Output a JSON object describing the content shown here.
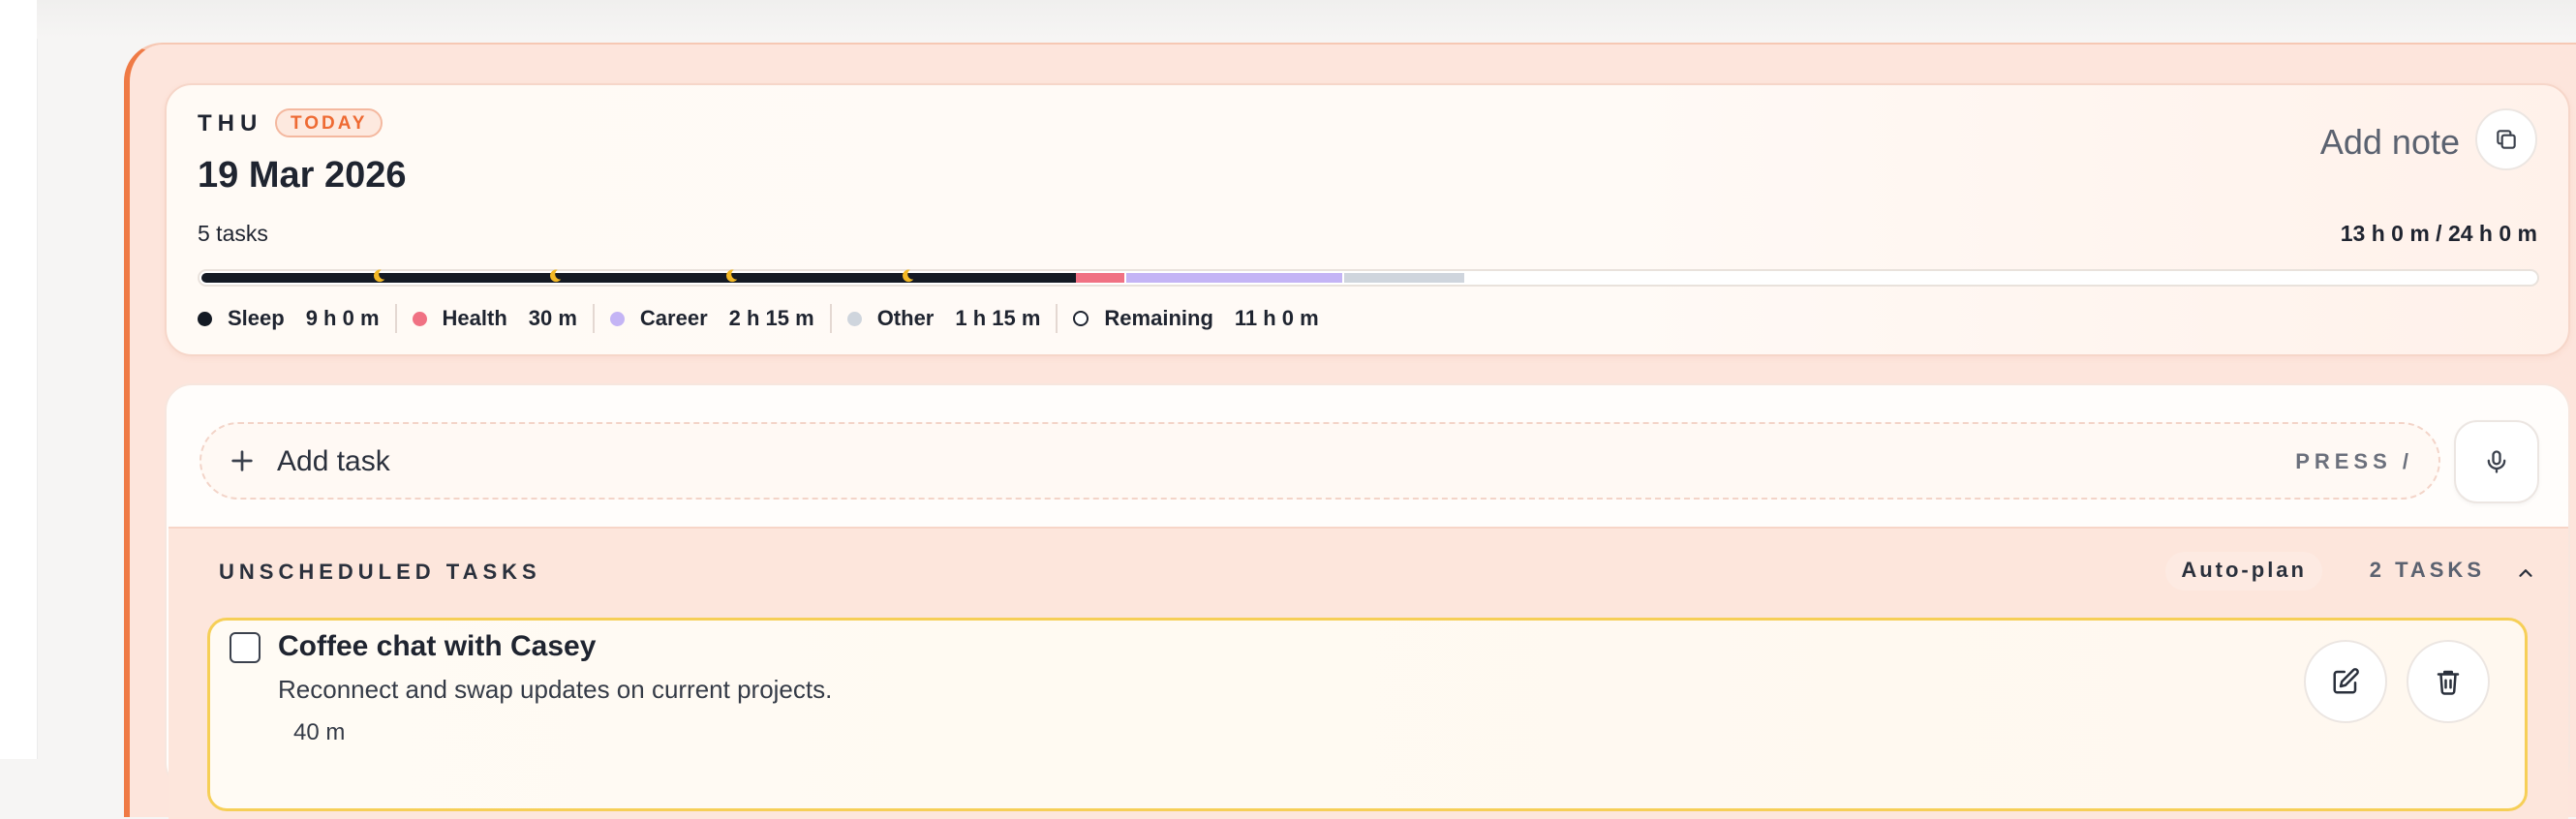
{
  "day": {
    "weekday": "THU",
    "today_badge": "TODAY",
    "date": "19 Mar 2026",
    "add_note_label": "Add note",
    "task_count": "5 tasks",
    "time_total": "13 h 0 m / 24 h 0 m"
  },
  "timeline": {
    "segments": [
      {
        "name": "Sleep",
        "fraction": 0.375,
        "color": "#141a24"
      },
      {
        "name": "Health",
        "fraction": 0.0208,
        "color": "#f07183"
      },
      {
        "name": "Career",
        "fraction": 0.0938,
        "color": "#c4b4f5"
      },
      {
        "name": "Other",
        "fraction": 0.0521,
        "color": "#cfd5dd"
      }
    ],
    "moon_icon": "moon-icon"
  },
  "legend": [
    {
      "label": "Sleep",
      "value": "9 h 0 m",
      "color": "#141a24"
    },
    {
      "label": "Health",
      "value": "30 m",
      "color": "#f07183"
    },
    {
      "label": "Career",
      "value": "2 h 15 m",
      "color": "#c4b4f5"
    },
    {
      "label": "Other",
      "value": "1 h 15 m",
      "color": "#cfd5dd"
    },
    {
      "label": "Remaining",
      "value": "11 h 0 m",
      "color": "#ffffff"
    }
  ],
  "add_task": {
    "label": "Add task",
    "hint": "PRESS /"
  },
  "unscheduled": {
    "title": "UNSCHEDULED TASKS",
    "autoplan_label": "Auto-plan",
    "count_label": "2 TASKS",
    "tasks": [
      {
        "title": "Coffee chat with Casey",
        "description": "Reconnect and swap updates on current projects.",
        "duration": "40 m"
      }
    ]
  },
  "colors": {
    "accent": "#ef7a45",
    "panel": "#fde5dc",
    "highlight_border": "#f6cf57"
  }
}
